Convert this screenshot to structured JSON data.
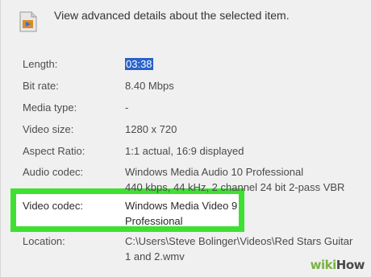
{
  "header": {
    "icon": "video-file-icon",
    "text": "View advanced details about the selected item."
  },
  "details": [
    {
      "label": "Length:",
      "value": "03:38",
      "selected": true
    },
    {
      "label": "Bit rate:",
      "value": "8.40 Mbps"
    },
    {
      "label": "Media type:",
      "value": "-"
    },
    {
      "label": "Video size:",
      "value": "1280 x 720"
    },
    {
      "label": "Aspect Ratio:",
      "value": "1:1 actual, 16:9 displayed"
    },
    {
      "label": "Audio codec:",
      "value_lines": [
        "Windows Media Audio 10 Professional",
        "440 kbps, 44 kHz, 2 channel 24 bit 2-pass VBR"
      ]
    },
    {
      "label": "Video codec:",
      "value_lines": [
        "Windows Media Video 9",
        "Professional"
      ],
      "highlighted": true
    },
    {
      "label": "Location:",
      "value_lines": [
        "C:\\Users\\Steve Bolinger\\Videos\\Red Stars Guitar",
        "1 and 2.wmv"
      ]
    }
  ],
  "colors": {
    "selection": "#2a62c9",
    "highlight_border": "#3ee032"
  },
  "watermark": {
    "part1": "wiki",
    "part2": "How"
  }
}
